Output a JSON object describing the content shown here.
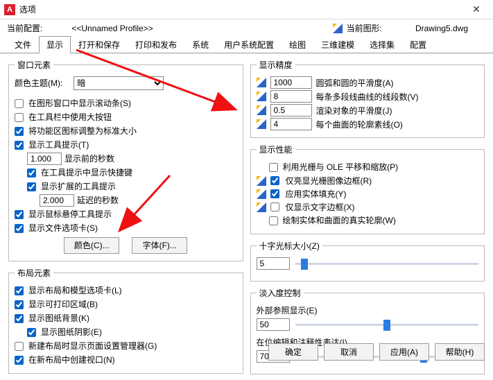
{
  "window": {
    "title": "选项",
    "close": "✕"
  },
  "profile": {
    "current_config_label": "当前配置:",
    "profile_name": "<<Unnamed Profile>>",
    "current_drawing_label": "当前图形:",
    "drawing_name": "Drawing5.dwg"
  },
  "tabs": [
    "文件",
    "显示",
    "打开和保存",
    "打印和发布",
    "系统",
    "用户系统配置",
    "绘图",
    "三维建模",
    "选择集",
    "配置"
  ],
  "active_tab": 1,
  "window_elements": {
    "legend": "窗口元素",
    "color_theme_label": "颜色主题(M):",
    "color_theme_value": "暗",
    "cb_scrollbar": "在图形窗口中显示滚动条(S)",
    "cb_big_buttons": "在工具栏中使用大按钮",
    "cb_ribbon_standard": "将功能区图标调整为标准大小",
    "cb_tooltips": "显示工具提示(T)",
    "seconds_value": "1.000",
    "seconds_label": "显示前的秒数",
    "cb_shortcut_in_tip": "在工具提示中显示快捷键",
    "cb_extended_tip": "显示扩展的工具提示",
    "delay_value": "2.000",
    "delay_label": "延迟的秒数",
    "cb_hover_tip": "显示鼠标悬停工具提示",
    "cb_file_tabs": "显示文件选项卡(S)",
    "btn_colors": "颜色(C)...",
    "btn_fonts": "字体(F)..."
  },
  "layout_elements": {
    "legend": "布局元素",
    "cb_layout_tabs": "显示布局和模型选项卡(L)",
    "cb_printable": "显示可打印区域(B)",
    "cb_paper_bg": "显示图纸背景(K)",
    "cb_paper_shadow": "显示图纸阴影(E)",
    "cb_page_setup": "新建布局时显示页面设置管理器(G)",
    "cb_create_viewport": "在新布局中创建视口(N)"
  },
  "display_precision": {
    "legend": "显示精度",
    "arc_val": "1000",
    "arc_label": "圆弧和圆的平滑度(A)",
    "seg_val": "8",
    "seg_label": "每条多段线曲线的线段数(V)",
    "rend_val": "0.5",
    "rend_label": "渲染对象的平滑度(J)",
    "surf_val": "4",
    "surf_label": "每个曲面的轮廓素线(O)"
  },
  "display_perf": {
    "legend": "显示性能",
    "cb_ole_pan": "利用光栅与 OLE 平移和缩放(P)",
    "cb_highlight_frame": "仅亮显光栅图像边框(R)",
    "cb_solid_fill": "应用实体填充(Y)",
    "cb_text_frame": "仅显示文字边框(X)",
    "cb_true_silhouette": "绘制实体和曲面的真实轮廓(W)"
  },
  "crosshair": {
    "label": "十字光标大小(Z)",
    "value": "5",
    "pct": 5
  },
  "fade": {
    "legend": "淡入度控制",
    "xref_label": "外部参照显示(E)",
    "xref_value": "50",
    "xref_pct": 50,
    "inplace_label": "在位编辑和注释性表达(I)",
    "inplace_value": "70",
    "inplace_pct": 70
  },
  "buttons": {
    "ok": "确定",
    "cancel": "取消",
    "apply": "应用(A)",
    "help": "帮助(H)"
  }
}
